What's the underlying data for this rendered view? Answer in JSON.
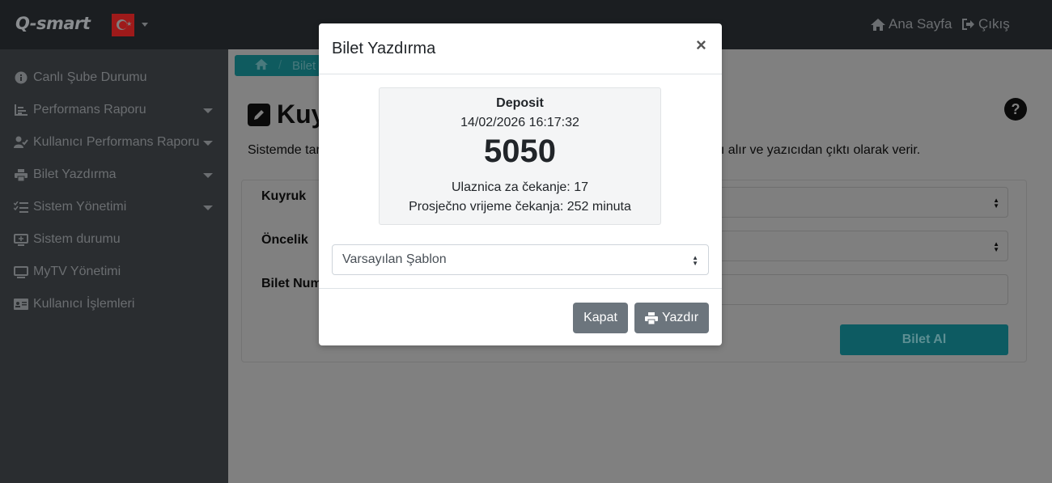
{
  "navbar": {
    "brand": "Q-smart",
    "home_label": "Ana Sayfa",
    "exit_label": "Çıkış",
    "flag_icon": "turkey-flag-icon"
  },
  "sidebar": {
    "items": [
      {
        "label": "Canlı Şube Durumu",
        "icon": "info-circle-icon",
        "has_caret": false
      },
      {
        "label": "Performans Raporu",
        "icon": "chart-icon",
        "has_caret": true
      },
      {
        "label": "Kullanıcı Performans Raporu",
        "icon": "user-check-icon",
        "has_caret": true
      },
      {
        "label": "Bilet Yazdırma",
        "icon": "printer-icon",
        "has_caret": true
      },
      {
        "label": "Sistem Yönetimi",
        "icon": "list-check-icon",
        "has_caret": true
      },
      {
        "label": "Sistem durumu",
        "icon": "monitor-icon",
        "has_caret": false
      },
      {
        "label": "MyTV Yönetimi",
        "icon": "tv-icon",
        "has_caret": false
      },
      {
        "label": "Kullanıcı İşlemleri",
        "icon": "id-card-icon",
        "has_caret": false
      }
    ]
  },
  "main": {
    "breadcrumb": "Bilet Y",
    "title": "Kuy",
    "description_start": "Sistemde tar",
    "description_end": "ası alır ve yazıcıdan çıktı olarak verir.",
    "form": {
      "queue_label": "Kuyruk",
      "priority_label": "Öncelik",
      "ticket_number_label": "Bilet Num",
      "submit_label": "Bilet Al"
    }
  },
  "modal": {
    "title": "Bilet Yazdırma",
    "close_symbol": "×",
    "ticket": {
      "service": "Deposit",
      "datetime": "14/02/2026 16:17:32",
      "number": "5050",
      "waiting": "Ulaznica za čekanje: 17",
      "avg_wait": "Prosječno vrijeme čekanja: 252 minuta"
    },
    "template_select": "Varsayılan Şablon",
    "close_button": "Kapat",
    "print_button": "Yazdır"
  },
  "colors": {
    "accent": "#17a2b8",
    "secondary": "#6c757d",
    "navbar": "#343a40"
  }
}
